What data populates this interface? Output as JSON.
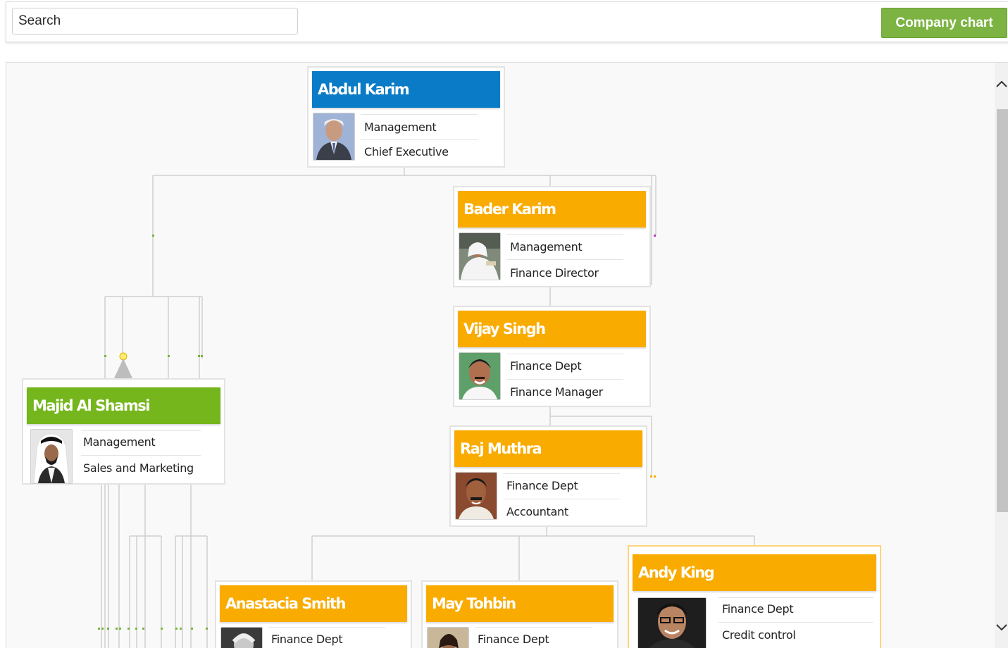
{
  "toolbar": {
    "search_placeholder": "Search",
    "company_chart_label": "Company chart"
  },
  "colors": {
    "ceo_header": "#0a7bc6",
    "dept_header": "#f9ab00",
    "sales_header": "#74b61c",
    "company_button": "#7cb342"
  },
  "org": {
    "cards": [
      {
        "name": "Abdul Karim",
        "field1": "Management",
        "field2": "Chief Executive"
      },
      {
        "name": "Bader Karim",
        "field1": "Management",
        "field2": "Finance Director"
      },
      {
        "name": "Vijay Singh",
        "field1": "Finance Dept",
        "field2": "Finance Manager"
      },
      {
        "name": "Majid Al Shamsi",
        "field1": "Management",
        "field2": "Sales and Marketing"
      },
      {
        "name": "Raj Muthra",
        "field1": "Finance Dept",
        "field2": "Accountant"
      },
      {
        "name": "Anastacia Smith",
        "field1": "Finance Dept",
        "field2": ""
      },
      {
        "name": "May Tohbin",
        "field1": "Finance Dept",
        "field2": ""
      },
      {
        "name": "Andy King",
        "field1": "Finance Dept",
        "field2": "Credit control"
      }
    ]
  }
}
